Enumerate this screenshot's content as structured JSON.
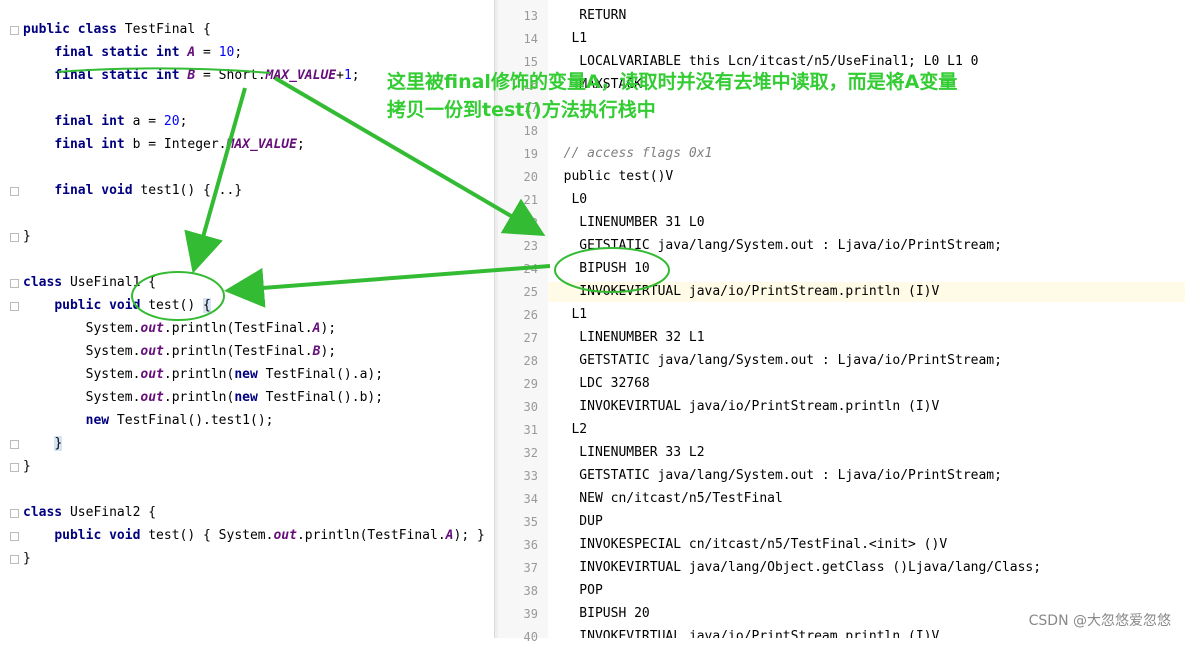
{
  "editor_left": {
    "lines": [
      {
        "tokens": [
          {
            "t": "public",
            "c": "kw"
          },
          {
            "t": " "
          },
          {
            "t": "class",
            "c": "kw"
          },
          {
            "t": " TestFinal {"
          }
        ]
      },
      {
        "tokens": [
          {
            "t": "    "
          },
          {
            "t": "final static int",
            "c": "kw"
          },
          {
            "t": " "
          },
          {
            "t": "A",
            "c": "fld"
          },
          {
            "t": " = "
          },
          {
            "t": "10",
            "c": "num"
          },
          {
            "t": ";"
          }
        ]
      },
      {
        "tokens": [
          {
            "t": "    "
          },
          {
            "t": "final static int",
            "c": "kw"
          },
          {
            "t": " "
          },
          {
            "t": "B",
            "c": "fld"
          },
          {
            "t": " = Short."
          },
          {
            "t": "MAX_VALUE",
            "c": "fld"
          },
          {
            "t": "+"
          },
          {
            "t": "1",
            "c": "num"
          },
          {
            "t": ";"
          }
        ]
      },
      {
        "tokens": []
      },
      {
        "tokens": [
          {
            "t": "    "
          },
          {
            "t": "final int",
            "c": "kw"
          },
          {
            "t": " a = "
          },
          {
            "t": "20",
            "c": "num"
          },
          {
            "t": ";"
          }
        ]
      },
      {
        "tokens": [
          {
            "t": "    "
          },
          {
            "t": "final int",
            "c": "kw"
          },
          {
            "t": " b = Integer."
          },
          {
            "t": "MAX_VALUE",
            "c": "fld"
          },
          {
            "t": ";"
          }
        ]
      },
      {
        "tokens": []
      },
      {
        "tokens": [
          {
            "t": "    "
          },
          {
            "t": "final void",
            "c": "kw"
          },
          {
            "t": " test1() {...}"
          }
        ]
      },
      {
        "tokens": []
      },
      {
        "tokens": [
          {
            "t": "}"
          }
        ]
      },
      {
        "tokens": []
      },
      {
        "tokens": [
          {
            "t": "class",
            "c": "kw"
          },
          {
            "t": " UseFinal1 {"
          }
        ]
      },
      {
        "tokens": [
          {
            "t": "    "
          },
          {
            "t": "public void",
            "c": "kw"
          },
          {
            "t": " test() "
          },
          {
            "t": "{",
            "c": "brace"
          }
        ]
      },
      {
        "tokens": [
          {
            "t": "        System."
          },
          {
            "t": "out",
            "c": "fld"
          },
          {
            "t": ".println(TestFinal."
          },
          {
            "t": "A",
            "c": "fld"
          },
          {
            "t": ");"
          }
        ]
      },
      {
        "tokens": [
          {
            "t": "        System."
          },
          {
            "t": "out",
            "c": "fld"
          },
          {
            "t": ".println(TestFinal."
          },
          {
            "t": "B",
            "c": "fld"
          },
          {
            "t": ");"
          }
        ]
      },
      {
        "tokens": [
          {
            "t": "        System."
          },
          {
            "t": "out",
            "c": "fld"
          },
          {
            "t": ".println("
          },
          {
            "t": "new",
            "c": "kw"
          },
          {
            "t": " TestFinal().a);"
          }
        ]
      },
      {
        "tokens": [
          {
            "t": "        System."
          },
          {
            "t": "out",
            "c": "fld"
          },
          {
            "t": ".println("
          },
          {
            "t": "new",
            "c": "kw"
          },
          {
            "t": " TestFinal().b);"
          }
        ]
      },
      {
        "tokens": [
          {
            "t": "        "
          },
          {
            "t": "new",
            "c": "kw"
          },
          {
            "t": " TestFinal().test1();"
          }
        ]
      },
      {
        "tokens": [
          {
            "t": "    "
          },
          {
            "t": "}",
            "c": "brace"
          }
        ]
      },
      {
        "tokens": [
          {
            "t": "}"
          }
        ]
      },
      {
        "tokens": []
      },
      {
        "tokens": [
          {
            "t": "class",
            "c": "kw"
          },
          {
            "t": " UseFinal2 {"
          }
        ]
      },
      {
        "tokens": [
          {
            "t": "    "
          },
          {
            "t": "public void",
            "c": "kw"
          },
          {
            "t": " test() { System."
          },
          {
            "t": "out",
            "c": "fld"
          },
          {
            "t": ".println(TestFinal."
          },
          {
            "t": "A",
            "c": "fld"
          },
          {
            "t": "); }"
          }
        ]
      },
      {
        "tokens": [
          {
            "t": "}"
          }
        ]
      }
    ]
  },
  "editor_right": {
    "lines": [
      {
        "n": "13",
        "text": "    RETURN"
      },
      {
        "n": "14",
        "text": "   L1"
      },
      {
        "n": "15",
        "text": "    LOCALVARIABLE this Lcn/itcast/n5/UseFinal1; L0 L1 0"
      },
      {
        "n": "16",
        "text": "    MAXSTACK"
      },
      {
        "n": "17",
        "text": ""
      },
      {
        "n": "18",
        "text": ""
      },
      {
        "n": "19",
        "text": "  // access flags 0x1",
        "cls": "cm"
      },
      {
        "n": "20",
        "text": "  public test()V"
      },
      {
        "n": "21",
        "text": "   L0"
      },
      {
        "n": "22",
        "text": "    LINENUMBER 31 L0"
      },
      {
        "n": "23",
        "text": "    GETSTATIC java/lang/System.out : Ljava/io/PrintStream;"
      },
      {
        "n": "24",
        "text": "    BIPUSH 10"
      },
      {
        "n": "25",
        "text": "    INVOKEVIRTUAL java/io/PrintStream.println (I)V",
        "hl": true
      },
      {
        "n": "26",
        "text": "   L1"
      },
      {
        "n": "27",
        "text": "    LINENUMBER 32 L1"
      },
      {
        "n": "28",
        "text": "    GETSTATIC java/lang/System.out : Ljava/io/PrintStream;"
      },
      {
        "n": "29",
        "text": "    LDC 32768"
      },
      {
        "n": "30",
        "text": "    INVOKEVIRTUAL java/io/PrintStream.println (I)V"
      },
      {
        "n": "31",
        "text": "   L2"
      },
      {
        "n": "32",
        "text": "    LINENUMBER 33 L2"
      },
      {
        "n": "33",
        "text": "    GETSTATIC java/lang/System.out : Ljava/io/PrintStream;"
      },
      {
        "n": "34",
        "text": "    NEW cn/itcast/n5/TestFinal"
      },
      {
        "n": "35",
        "text": "    DUP"
      },
      {
        "n": "36",
        "text": "    INVOKESPECIAL cn/itcast/n5/TestFinal.<init> ()V"
      },
      {
        "n": "37",
        "text": "    INVOKEVIRTUAL java/lang/Object.getClass ()Ljava/lang/Class;"
      },
      {
        "n": "38",
        "text": "    POP"
      },
      {
        "n": "39",
        "text": "    BIPUSH 20"
      },
      {
        "n": "40",
        "text": "    INVOKEVIRTUAL java/io/PrintStream.println (I)V"
      }
    ]
  },
  "annotation": {
    "line1": "这里被final修饰的变量A，读取时并没有去堆中读取，而是将A变量",
    "line2": "拷贝一份到test()方法执行栈中"
  },
  "watermark": "CSDN @大忽悠爱忽悠",
  "colors": {
    "annotation": "#33cc33",
    "keyword": "#000080",
    "field": "#660e7a",
    "number": "#0000ff",
    "comment": "#808080"
  }
}
